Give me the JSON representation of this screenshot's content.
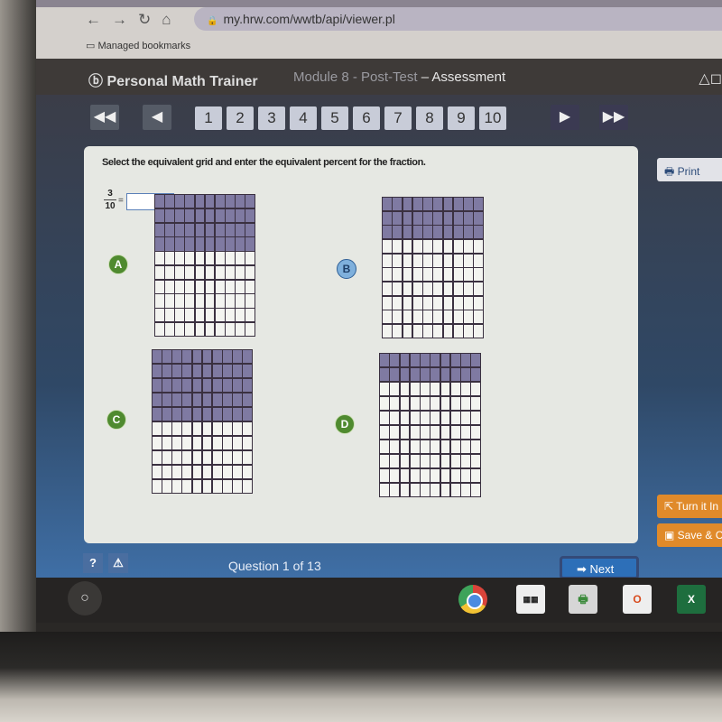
{
  "browser": {
    "nav_icons": [
      "back-arrow-icon",
      "forward-arrow-icon",
      "reload-icon",
      "home-icon"
    ],
    "url": "my.hrw.com/wwtb/api/viewer.pl",
    "bookmarks_label": "Managed bookmarks"
  },
  "app": {
    "brand": "Personal Math Trainer",
    "module": "Module 8 - Post-Test",
    "section": "– Assessment"
  },
  "question_nav": {
    "first_icon": "double-left-arrow-icon",
    "prev_icon": "left-arrow-icon",
    "next_icon": "right-arrow-icon",
    "last_icon": "double-right-arrow-icon",
    "pages": [
      "1",
      "2",
      "3",
      "4",
      "5",
      "6",
      "7",
      "8",
      "9",
      "10"
    ]
  },
  "question": {
    "prompt": "Select the equivalent grid and enter the equivalent percent for the fraction.",
    "numerator": "3",
    "denominator": "10",
    "equals": "=",
    "answer_value": "",
    "percent_sign": "%"
  },
  "options": [
    {
      "label": "A",
      "shaded_rows": 4,
      "total_rows": 10,
      "columns": 10,
      "selected": false
    },
    {
      "label": "B",
      "shaded_rows": 3,
      "total_rows": 10,
      "columns": 10,
      "selected": true
    },
    {
      "label": "C",
      "shaded_rows": 5,
      "total_rows": 10,
      "columns": 10,
      "selected": false
    },
    {
      "label": "D",
      "shaded_rows": 2,
      "total_rows": 10,
      "columns": 10,
      "selected": false
    }
  ],
  "side_buttons": {
    "print": "Print",
    "turn_in": "Turn it In",
    "save": "Save & C"
  },
  "footer": {
    "help": "?",
    "alert": "⚠",
    "question_count": "Question 1 of 13",
    "next": "Next"
  },
  "colors": {
    "shaded": "#7f7aa2",
    "option_green": "#4f8a2f",
    "option_selected": "#7fb0dc",
    "orange": "#e08a2a",
    "next_blue": "#2d6fb8"
  }
}
